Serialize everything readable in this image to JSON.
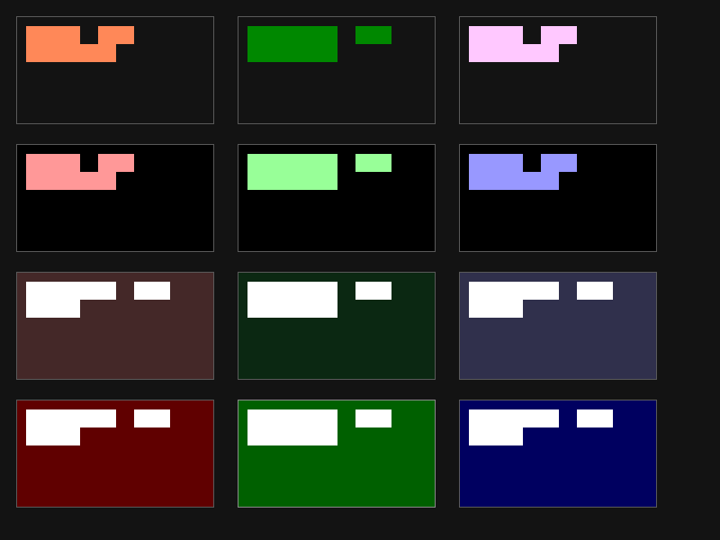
{
  "panels": [
    {
      "background": "#131313",
      "border": "#5a5a5a",
      "fill": "#ff8858",
      "pattern": "a"
    },
    {
      "background": "#131313",
      "border": "#5a5a5a",
      "fill": "#008800",
      "pattern": "b"
    },
    {
      "background": "#131313",
      "border": "#5a5a5a",
      "fill": "#ffc8ff",
      "pattern": "a"
    },
    {
      "background": "#000000",
      "border": "#5a5a5a",
      "fill": "#ff9898",
      "pattern": "a"
    },
    {
      "background": "#000000",
      "border": "#5a5a5a",
      "fill": "#98ff98",
      "pattern": "b"
    },
    {
      "background": "#000000",
      "border": "#5a5a5a",
      "fill": "#9898ff",
      "pattern": "a"
    },
    {
      "background": "#442828",
      "border": "#5a5a5a",
      "fill": "#ffffff",
      "pattern": "c"
    },
    {
      "background": "#0b2812",
      "border": "#5a5a5a",
      "fill": "#ffffff",
      "pattern": "b"
    },
    {
      "background": "#30304c",
      "border": "#5a5a5a",
      "fill": "#ffffff",
      "pattern": "c"
    },
    {
      "background": "#600000",
      "border": "#5a5a5a",
      "fill": "#ffffff",
      "pattern": "c"
    },
    {
      "background": "#006000",
      "border": "#8a8a8a",
      "fill": "#ffffff",
      "pattern": "b"
    },
    {
      "background": "#000060",
      "border": "#5a5a5a",
      "fill": "#ffffff",
      "pattern": "c"
    }
  ]
}
